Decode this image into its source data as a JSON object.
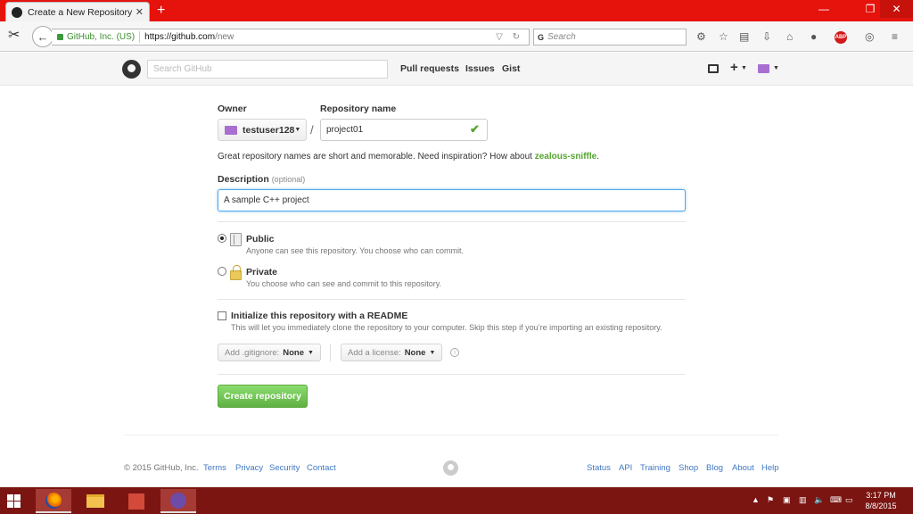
{
  "browser": {
    "tab_title": "Create a New Repository",
    "tab_close": "✕",
    "new_tab": "+",
    "window_min": "—",
    "window_max": "❐",
    "window_close": "✕",
    "identity": "GitHub, Inc. (US)",
    "url_host": "https://github.com",
    "url_path": "/new",
    "search_placeholder": "Search",
    "search_engine": "G"
  },
  "github_header": {
    "search_placeholder": "Search GitHub",
    "nav": [
      "Pull requests",
      "Issues",
      "Gist"
    ]
  },
  "form": {
    "owner_label": "Owner",
    "owner_value": "testuser128",
    "repo_label": "Repository name",
    "repo_value": "project01",
    "separator": "/",
    "hint_text": "Great repository names are short and memorable. Need inspiration? How about ",
    "hint_suggestion": "zealous-sniffle",
    "hint_end": ".",
    "description_label": "Description",
    "description_optional": "(optional)",
    "description_value": "A sample C++ project",
    "public_title": "Public",
    "public_sub": "Anyone can see this repository. You choose who can commit.",
    "private_title": "Private",
    "private_sub": "You choose who can see and commit to this repository.",
    "readme_title": "Initialize this repository with a README",
    "readme_sub": "This will let you immediately clone the repository to your computer. Skip this step if you’re importing an existing repository.",
    "gitignore_label": "Add .gitignore:",
    "gitignore_value": "None",
    "license_label": "Add a license:",
    "license_value": "None",
    "info_glyph": "i",
    "create_button": "Create repository"
  },
  "footer": {
    "copyright": "© 2015 GitHub, Inc.",
    "left_links": [
      "Terms",
      "Privacy",
      "Security",
      "Contact"
    ],
    "right_links": [
      "Status",
      "API",
      "Training",
      "Shop",
      "Blog",
      "About",
      "Help"
    ]
  },
  "taskbar": {
    "time": "3:17 PM",
    "date": "8/8/2015"
  },
  "colors": {
    "browser_red": "#e6120c",
    "link_blue": "#4078c0",
    "create_green": "#60b044",
    "taskbar": "#7a1512"
  }
}
